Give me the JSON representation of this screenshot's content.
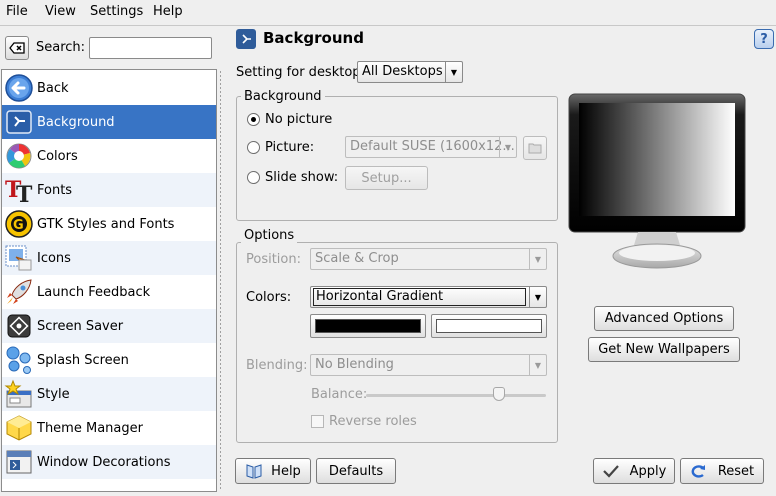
{
  "menu": {
    "file": "File",
    "view": "View",
    "settings": "Settings",
    "help": "Help"
  },
  "search": {
    "label": "Search:",
    "value": ""
  },
  "sidebar": {
    "items": [
      {
        "label": "Back",
        "icon": "back-arrow-icon"
      },
      {
        "label": "Background",
        "icon": "background-icon",
        "selected": true
      },
      {
        "label": "Colors",
        "icon": "colors-icon"
      },
      {
        "label": "Fonts",
        "icon": "fonts-icon"
      },
      {
        "label": "GTK Styles and Fonts",
        "icon": "gtk-icon"
      },
      {
        "label": "Icons",
        "icon": "icons-icon"
      },
      {
        "label": "Launch Feedback",
        "icon": "rocket-icon"
      },
      {
        "label": "Screen Saver",
        "icon": "screensaver-icon"
      },
      {
        "label": "Splash Screen",
        "icon": "splash-icon"
      },
      {
        "label": "Style",
        "icon": "style-icon"
      },
      {
        "label": "Theme Manager",
        "icon": "theme-icon"
      },
      {
        "label": "Window Decorations",
        "icon": "window-decorations-icon"
      }
    ]
  },
  "header": {
    "title": "Background",
    "help": "?"
  },
  "desktop": {
    "label": "Setting for desktop:",
    "value": "All Desktops"
  },
  "background_group": {
    "title": "Background",
    "no_picture": "No picture",
    "picture": "Picture:",
    "picture_value": "Default SUSE (1600x12...",
    "slideshow": "Slide show:",
    "setup": "Setup..."
  },
  "options_group": {
    "title": "Options",
    "position_label": "Position:",
    "position_value": "Scale & Crop",
    "colors_label": "Colors:",
    "colors_value": "Horizontal Gradient",
    "color1": "#000000",
    "color2": "#ffffff",
    "blending_label": "Blending:",
    "blending_value": "No Blending",
    "balance_label": "Balance:",
    "balance_value": 0.74,
    "reverse_label": "Reverse roles"
  },
  "right": {
    "advanced": "Advanced Options",
    "get_new": "Get New Wallpapers"
  },
  "footer": {
    "help": "Help",
    "defaults": "Defaults",
    "apply": "Apply",
    "reset": "Reset"
  },
  "colors": {
    "selection": "#3874c5",
    "alt_row": "#eef3fa"
  }
}
